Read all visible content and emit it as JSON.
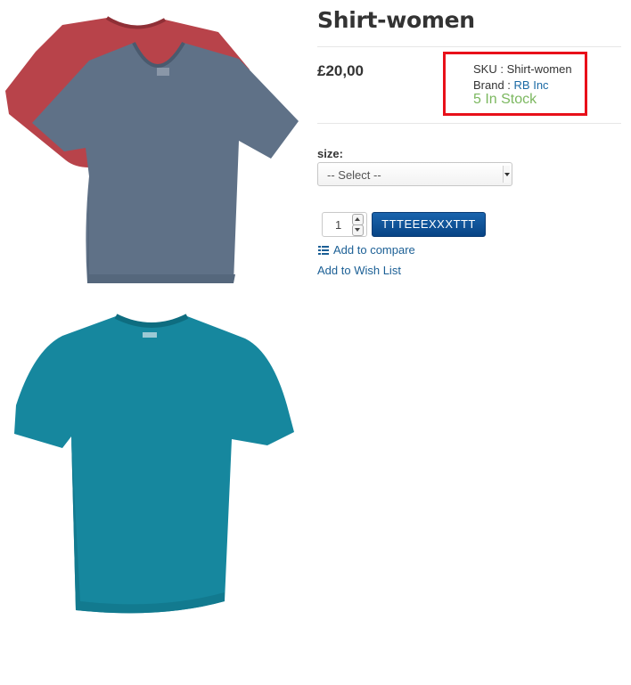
{
  "product": {
    "title": "Shirt-women",
    "price": "£20,00",
    "sku_label": "SKU : ",
    "sku_value": "Shirt-women",
    "brand_label": "Brand : ",
    "brand_value": "RB Inc",
    "stock": "5 In Stock"
  },
  "options": {
    "size_label": "size:",
    "size_selected": "-- Select --"
  },
  "cart": {
    "quantity": "1",
    "add_button": "TTTEEEXXXTTT"
  },
  "links": {
    "compare": "Add to compare",
    "wishlist": "Add to Wish List"
  },
  "colors": {
    "accent": "#1b5f95",
    "stock_green": "#7cb860",
    "highlight_border": "#e8101a",
    "button": "#074485"
  }
}
